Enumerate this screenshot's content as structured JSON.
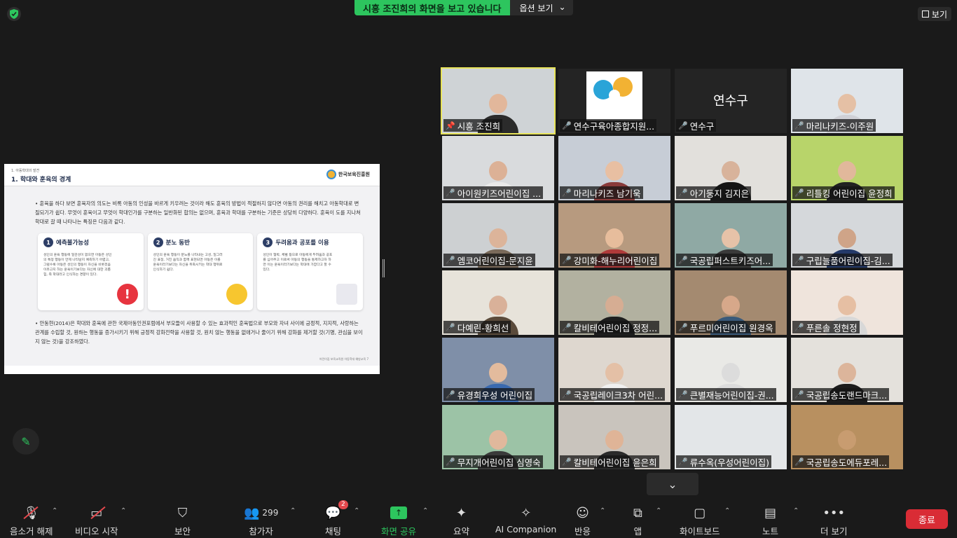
{
  "banner": {
    "sharing_text": "시흥 조진희의 화면을 보고 있습니다",
    "options_label": "옵션 보기"
  },
  "view_label": "보기",
  "slide": {
    "section": "1. 아동학대의 발견",
    "title": "1. 학대와 훈육의 경계",
    "org": "한국보육진흥원",
    "para1": "• 훈육을 하다 보면 훈육자의 의도는 비록 아동의 인성을 바르게 키우려는 것이라 해도 훈육의 방법이 적절하지 않다면 아동의 권리를 해치고 아동학대로 변질되기가 쉽다. 무엇이 훈육이고 무엇이 학대인가를 구분하는 일반화된 합의는 없으며, 훈육과 학대를 구분하는 기준은 상당히 다양하다. 훈육이 도를 지나쳐 학대로 갈 때 나타나는 특징은 다음과 같다.",
    "cards": [
      {
        "num": "1",
        "title": "예측불가능성",
        "text": "성인의 훈육 행동에 일관성이 없으면 아동은 성인의 특정 행동이 언제 나타날지 예측하기 어렵고, 그럴수록 아동은 성인의 행동이 자신을 비롯겠음 이유고지 하는 훈육이기보다는 자신에 대한 괴롭힘, 즉 학대라고 인식하는 경향이 있다."
      },
      {
        "num": "2",
        "title": "분노 동반",
        "text": "성인의 훈육 행동이 분노를 나타내는 고성, 일그러진 표정, 거친 움직과 함께 표현되면 아동은 이를 훈육이라기보다는 자신을 위축시키는 학대 행위로 인식하기 쉽다."
      },
      {
        "num": "3",
        "title": "두려움과 공포를 이용",
        "text": "성인이 협박, 체벌 등으로 아동에게 두려움과 공포를 심어주고 이로써 아동의 행동을 통제하고자 하면 이는 훈육이라기보다는 학대에 가깝다고 할 수 있다."
      }
    ],
    "para2": "• 안동현(2014)은 학대와 훈육에 관한 국제아동인권포럼에서 부모들이 사용할 수 있는 효과적인 훈육법으로 부모와 자녀 사이에 긍정적, 지지적, 사랑하는 관계를 수립할 것, 원하는 행동을 증가시키기 위해 긍정적 강화전략을 사용할 것, 원치 않는 행동을 없애거나 줄이기 위해 강화를 제거할 것(기명, 관심을 보이지 않는 것)을 강조하였다.",
    "footer": "어린이집 보육교직원 아동학대 예방교육   7"
  },
  "participants": [
    {
      "name": "시흥 조진희",
      "active": true,
      "muted": false,
      "bg": "#cfd3d6",
      "skin": "#e2b79b",
      "shirt": "#2b2b2b"
    },
    {
      "name": "연수구육아종합지원...",
      "muted": true,
      "type": "logo"
    },
    {
      "name": "연수구",
      "muted": true,
      "type": "name",
      "display": "연수구"
    },
    {
      "name": "마리나키즈-이주원",
      "muted": true,
      "bg": "#dfe4e9",
      "skin": "#e5c0a5",
      "shirt": "#cfd0d6"
    },
    {
      "name": "아이원키즈어린이집 ...",
      "muted": true,
      "bg": "#d9dbdd",
      "skin": "#dcb196",
      "shirt": "#e9e9e9"
    },
    {
      "name": "마리나키즈 남기욱",
      "muted": true,
      "bg": "#c7cdd6",
      "skin": "#e8bfa2",
      "shirt": "#8a3a3a"
    },
    {
      "name": "아기둥지 김지은",
      "muted": true,
      "bg": "#e2e0dc",
      "skin": "#d8b39b",
      "shirt": "#151515"
    },
    {
      "name": "리틀킹 어린이집 윤정희",
      "muted": true,
      "bg": "#b8d46a",
      "skin": "#e1b89b",
      "shirt": "#222222"
    },
    {
      "name": "엠코어린이집-문지윤",
      "muted": true,
      "bg": "#cdd0d2",
      "skin": "#dcb49a",
      "shirt": "#7a6a5a"
    },
    {
      "name": "강미화-해누리어린이집",
      "muted": true,
      "bg": "#b79a7f",
      "skin": "#e7bd9c",
      "shirt": "#b03a3a"
    },
    {
      "name": "국공립퍼스트키즈어...",
      "muted": true,
      "bg": "#8fa9a4",
      "skin": "#e6c2a8",
      "shirt": "#3a3a3a"
    },
    {
      "name": "구립늘품어린이집-김...",
      "muted": true,
      "bg": "#d5d8db",
      "skin": "#cfa488",
      "shirt": "#243a6a"
    },
    {
      "name": "다예린-황희선",
      "muted": true,
      "bg": "#e7e3da",
      "skin": "#d9b199",
      "shirt": "#5a4a3a"
    },
    {
      "name": "칼비테어린이집 정정...",
      "muted": true,
      "bg": "#b2b1a0",
      "skin": "#d6ad93",
      "shirt": "#1e1e1e"
    },
    {
      "name": "푸르미어린이집 원경옥",
      "muted": true,
      "bg": "#a48a70",
      "skin": "#d7a88a",
      "shirt": "#3a5a7a"
    },
    {
      "name": "푸른솔 정현정",
      "muted": true,
      "bg": "#efe4dc",
      "skin": "#e6bfa3",
      "shirt": "#d8d8d8"
    },
    {
      "name": "유경희우성 어린이집",
      "muted": true,
      "bg": "#7f8fa8",
      "skin": "#e3bb9d",
      "shirt": "#3a6ab0"
    },
    {
      "name": "국공립레이크3차 어린...",
      "muted": true,
      "bg": "#ded7cf",
      "skin": "#e4c0a6",
      "shirt": "#f0f0f0"
    },
    {
      "name": "큰별재능어린이집-권...",
      "muted": true,
      "bg": "#e9e9e6",
      "skin": "#dcdcdc",
      "shirt": "#dcdcdc"
    },
    {
      "name": "국공립송도랜드마크...",
      "muted": true,
      "bg": "#e4e1dc",
      "skin": "#dcb59b",
      "shirt": "#1c1c1c"
    },
    {
      "name": "무지개어린이집 심영숙",
      "muted": true,
      "bg": "#9cc3a6",
      "skin": "#e0b89c",
      "shirt": "#3a3a3a"
    },
    {
      "name": "칼비테어린이집 윤은희",
      "muted": true,
      "bg": "#c9c4bd",
      "skin": "#dfb497",
      "shirt": "#2a2a2a"
    },
    {
      "name": "류수옥(우성어린이집)",
      "muted": true,
      "bg": "#e3e6e8",
      "skin": "#e3e6e8",
      "shirt": "#e3e6e8"
    },
    {
      "name": "국공립송도에듀포레...",
      "muted": true,
      "bg": "#b89060",
      "skin": "#c89c70",
      "shirt": "#b89060"
    }
  ],
  "toolbar": {
    "mute_label": "음소거 해제",
    "video_label": "비디오 시작",
    "security_label": "보안",
    "participants_label": "참가자",
    "participants_count": "299",
    "chat_label": "채팅",
    "chat_badge": "2",
    "share_label": "화면 공유",
    "summary_label": "요약",
    "ai_label": "AI Companion",
    "reaction_label": "반응",
    "apps_label": "앱",
    "whiteboard_label": "화이트보드",
    "notes_label": "노트",
    "more_label": "더 보기",
    "end_label": "종료"
  },
  "colors": {
    "accent": "#2dc55e",
    "active_border": "#e8e45a",
    "end": "#d92c35",
    "muted": "#e5484d"
  },
  "icons": [
    "shield-icon",
    "pen-icon",
    "mic-off-icon",
    "video-off-icon",
    "security-icon",
    "participants-icon",
    "chat-icon",
    "share-screen-icon",
    "summary-icon",
    "ai-companion-icon",
    "reaction-icon",
    "apps-icon",
    "whiteboard-icon",
    "notes-icon",
    "more-icon",
    "chevron-down-icon"
  ]
}
